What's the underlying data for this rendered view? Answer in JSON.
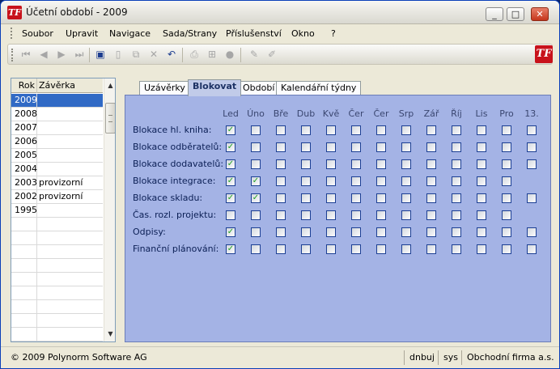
{
  "window": {
    "title": "Účetní období - 2009",
    "app_icon": "TF",
    "controls": [
      "minimize-icon",
      "maximize-icon",
      "close-icon"
    ]
  },
  "menubar": {
    "items": [
      "Soubor",
      "Upravit",
      "Navigace",
      "Sada/Strany",
      "Příslušenství",
      "Okno",
      "?"
    ]
  },
  "toolbar": {
    "icons": [
      "first-record-icon",
      "previous-record-icon",
      "next-record-icon",
      "last-record-icon",
      "save-icon",
      "new-icon",
      "copy-icon",
      "delete-icon",
      "undo-icon",
      "print-icon",
      "tree-icon",
      "stop-icon",
      "edit-icon",
      "edit-alt-icon"
    ]
  },
  "year_list": {
    "headers": [
      "Rok",
      "Závěrka"
    ],
    "rows": [
      {
        "year": "2009",
        "closing": ""
      },
      {
        "year": "2008",
        "closing": ""
      },
      {
        "year": "2007",
        "closing": ""
      },
      {
        "year": "2006",
        "closing": ""
      },
      {
        "year": "2005",
        "closing": ""
      },
      {
        "year": "2004",
        "closing": ""
      },
      {
        "year": "2003",
        "closing": "provizorní"
      },
      {
        "year": "2002",
        "closing": "provizorní"
      },
      {
        "year": "1995",
        "closing": ""
      }
    ],
    "selected_year": "2009"
  },
  "tabs": [
    {
      "label": "Uzávěrky",
      "active": false
    },
    {
      "label": "Blokovat",
      "active": true
    },
    {
      "label": "Období",
      "active": false
    },
    {
      "label": "Kalendářní týdny",
      "active": false
    }
  ],
  "block_grid": {
    "columns": [
      "Led",
      "Úno",
      "Bře",
      "Dub",
      "Kvě",
      "Čer",
      "Čer",
      "Srp",
      "Zář",
      "Říj",
      "Lis",
      "Pro",
      "13."
    ],
    "rows": [
      {
        "label": "Blokace hl. kniha:",
        "checked": [
          true,
          false,
          false,
          false,
          false,
          false,
          false,
          false,
          false,
          false,
          false,
          false,
          false
        ],
        "has13": true
      },
      {
        "label": "Blokace odběratelů:",
        "checked": [
          true,
          false,
          false,
          false,
          false,
          false,
          false,
          false,
          false,
          false,
          false,
          false,
          false
        ],
        "has13": true
      },
      {
        "label": "Blokace dodavatelů:",
        "checked": [
          true,
          false,
          false,
          false,
          false,
          false,
          false,
          false,
          false,
          false,
          false,
          false,
          false
        ],
        "has13": true
      },
      {
        "label": "Blokace integrace:",
        "checked": [
          true,
          true,
          false,
          false,
          false,
          false,
          false,
          false,
          false,
          false,
          false,
          false
        ],
        "has13": false
      },
      {
        "label": "Blokace skladu:",
        "checked": [
          true,
          true,
          false,
          false,
          false,
          false,
          false,
          false,
          false,
          false,
          false,
          false,
          false
        ],
        "has13": true
      },
      {
        "label": "Čas. rozl. projektu:",
        "checked": [
          false,
          false,
          false,
          false,
          false,
          false,
          false,
          false,
          false,
          false,
          false,
          false
        ],
        "has13": false
      },
      {
        "label": "Odpisy:",
        "checked": [
          true,
          false,
          false,
          false,
          false,
          false,
          false,
          false,
          false,
          false,
          false,
          false,
          false
        ],
        "has13": true
      },
      {
        "label": "Finanční plánování:",
        "checked": [
          true,
          false,
          false,
          false,
          false,
          false,
          false,
          false,
          false,
          false,
          false,
          false,
          false
        ],
        "has13": true
      }
    ]
  },
  "statusbar": {
    "copyright": "© 2009 Polynorm Software AG",
    "user": "dnbuj",
    "system": "sys",
    "company": "Obchodní firma a.s."
  },
  "colors": {
    "panel_bg": "#a4b3e5",
    "selection": "#316ac5",
    "check": "#21a121"
  }
}
